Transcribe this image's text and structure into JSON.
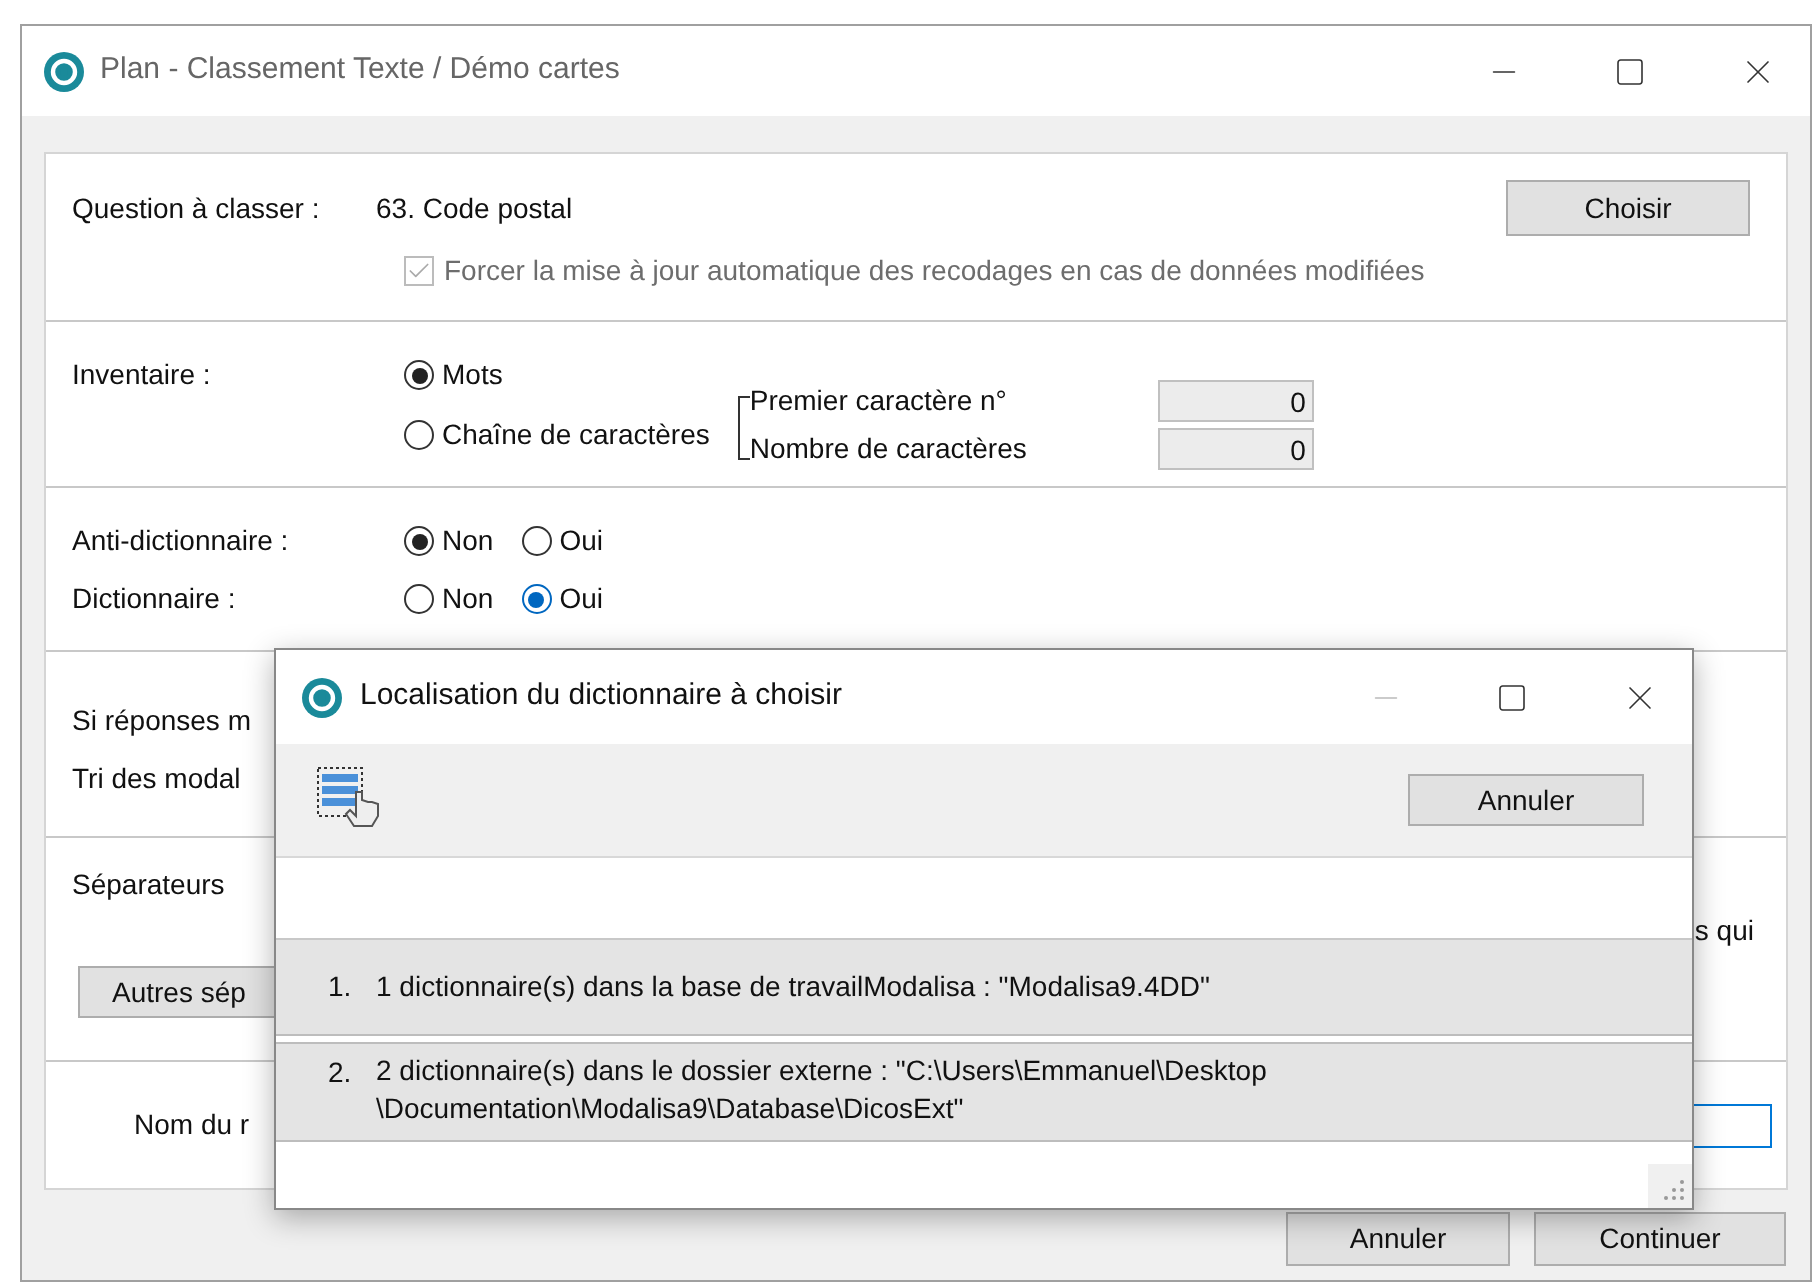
{
  "window": {
    "title": "Plan - Classement Texte / Démo cartes"
  },
  "question": {
    "label": "Question à classer :",
    "value": "63. Code postal",
    "button": "Choisir",
    "force_update": {
      "label": "Forcer la mise à jour automatique des recodages en cas de données modifiées",
      "checked": true,
      "disabled": true
    }
  },
  "inventory": {
    "label": "Inventaire :",
    "options": [
      {
        "label": "Mots",
        "selected": true
      },
      {
        "label": "Chaîne de caractères",
        "selected": false
      }
    ],
    "fields": [
      {
        "label": "Premier caractère n°",
        "value": "0"
      },
      {
        "label": "Nombre de caractères",
        "value": "0"
      }
    ]
  },
  "dictionaries": [
    {
      "label": "Anti-dictionnaire :",
      "options": [
        {
          "label": "Non",
          "selected": true
        },
        {
          "label": "Oui",
          "selected": false
        }
      ]
    },
    {
      "label": "Dictionnaire :",
      "options": [
        {
          "label": "Non",
          "selected": false
        },
        {
          "label": "Oui",
          "selected": true
        }
      ]
    }
  ],
  "sorting": {
    "lines": [
      "Si réponses m",
      "Tri des modal"
    ]
  },
  "separators": {
    "label": "Séparateurs",
    "right_text": "s qui",
    "button": "Autres sép"
  },
  "name_row": {
    "label": "Nom du r"
  },
  "buttons": [
    "Annuler",
    "Continuer"
  ],
  "dialog": {
    "title": "Localisation du dictionnaire à choisir",
    "button": "Annuler",
    "items": [
      {
        "number": "1.",
        "lines": [
          "1 dictionnaire(s) dans la base de travailModalisa : \"Modalisa9.4DD\""
        ]
      },
      {
        "number": "2.",
        "lines": [
          "2 dictionnaire(s) dans le dossier externe : \"C:\\Users\\Emmanuel\\Desktop",
          "\\Documentation\\Modalisa9\\Database\\DicosExt\""
        ]
      }
    ]
  }
}
